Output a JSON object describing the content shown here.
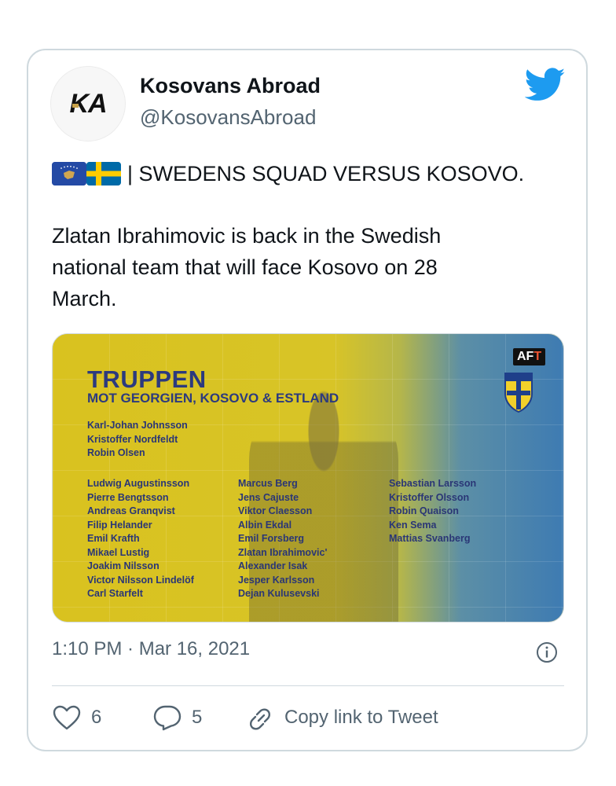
{
  "author": {
    "avatar_text": "KA",
    "display_name": "Kosovans Abroad",
    "handle": "@KosovansAbroad"
  },
  "tweet": {
    "line1": "| SWEDENS SQUAD VERSUS KOSOVO.",
    "body_lines": [
      "Zlatan Ibrahimovic is back in the Swedish",
      "national team that will face Kosovo on 28",
      "March."
    ]
  },
  "media": {
    "badge_text": "AF",
    "badge_accent": "T",
    "title": "TRUPPEN",
    "subtitle": "MOT GEORGIEN, KOSOVO & ESTLAND",
    "goalkeepers": [
      "Karl-Johan Johnsson",
      "Kristoffer Nordfeldt",
      "Robin Olsen"
    ],
    "col1": [
      "Ludwig Augustinsson",
      "Pierre Bengtsson",
      "Andreas Granqvist",
      "Filip Helander",
      "Emil Krafth",
      "Mikael Lustig",
      "Joakim Nilsson",
      "Victor Nilsson Lindelöf",
      "Carl Starfelt"
    ],
    "col2": [
      "Marcus Berg",
      "Jens Cajuste",
      "Viktor Claesson",
      "Albin Ekdal",
      "Emil Forsberg",
      "Zlatan Ibrahimovic'",
      "Alexander Isak",
      "Jesper Karlsson",
      "Dejan Kulusevski"
    ],
    "col3": [
      "Sebastian Larsson",
      "Kristoffer Olsson",
      "Robin Quaison",
      "Ken Sema",
      "Mattias Svanberg"
    ]
  },
  "timestamp": "1:10 PM · Mar 16, 2021",
  "actions": {
    "likes": "6",
    "replies": "5",
    "copy_link": "Copy link to Tweet"
  },
  "colors": {
    "twitter_blue": "#1d9bf0",
    "secondary_text": "#536471",
    "border": "#cfd9de"
  }
}
